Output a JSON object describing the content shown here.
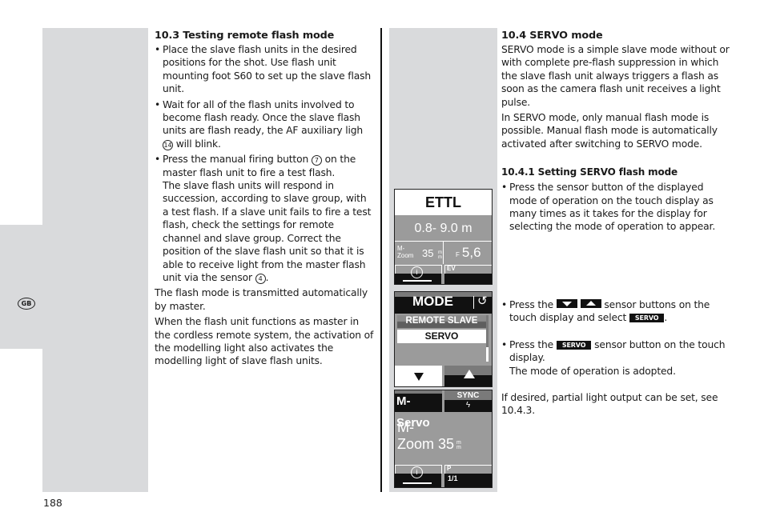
{
  "page": {
    "number": "188",
    "language_badge": "GB"
  },
  "left": {
    "heading": "10.3 Testing remote flash mode",
    "bullets": [
      {
        "text": "Place the slave flash units in the desired positions for the shot. Use flash unit mounting foot S60 to set up the slave flash unit."
      },
      {
        "pre": "Wait for all of the flash units involved to become flash ready. Once the slave flash units are flash ready, the AF auxiliary ligh ",
        "ref": "14",
        "post": " will blink."
      },
      {
        "pre": "Press the manual firing button ",
        "ref": "7",
        "mid": " on the master flash unit to fire a test flash.",
        "extra_pre": "The slave flash units will respond in succession, according to slave group, with a test flash. If a slave unit fails to fire a test flash, check the settings for remote channel and slave group. Correct the position of the slave flash unit so that it is able to receive light from the master flash unit via the sensor ",
        "ref2": "4",
        "extra_post": "."
      }
    ],
    "paragraphs": [
      "The flash mode is transmitted automatically by master.",
      "When the flash unit functions as master in the cordless remote system, the activation of the modelling light also activates the modelling light of slave flash units."
    ]
  },
  "screens": {
    "ettl": {
      "title": "ETTL",
      "range": "0.8- 9.0 m",
      "zoom_label_1": "M-",
      "zoom_label_2": "Zoom",
      "zoom_value": "35",
      "zoom_unit_1": "m",
      "zoom_unit_2": "m",
      "aperture_label": "F",
      "aperture_value": "5,6",
      "info_icon": "i",
      "ev_label": "EV"
    },
    "mode": {
      "title": "MODE",
      "back_icon": "↺",
      "options": [
        "REMOTE SLAVE",
        "SERVO"
      ],
      "selected": "SERVO",
      "scroll_position": 0.7
    },
    "mservo": {
      "title": "M-Servo",
      "sync_label": "SYNC",
      "sync_icon": "ϟ",
      "zoom_label": "M-",
      "zoom_text": "Zoom 35",
      "zoom_unit_1": "m",
      "zoom_unit_2": "m",
      "info_icon": "i",
      "p_label": "P",
      "page_indicator": "1/1"
    }
  },
  "right": {
    "heading": "10.4 SERVO mode",
    "paragraphs": [
      "SERVO mode is a simple slave mode without or with complete pre-flash suppression in which the slave flash unit always triggers a flash as soon as the camera flash unit receives a light pulse.",
      "In SERVO mode, only manual flash mode is possible. Manual flash mode is automatically activated after switching to SERVO mode."
    ],
    "subheading": "10.4.1 Setting SERVO flash mode",
    "step1": "Press the sensor button of the displayed mode of operation on the touch display as many times as it takes for the display for selecting the mode of operation to appear.",
    "step2_pre": "Press the",
    "step2_post": "sensor buttons on the touch display and select",
    "step2_end": ".",
    "step3_pre": "Press the",
    "step3_post": "sensor button on the touch display.",
    "step3_line2": "The mode of operation is adopted.",
    "servo_button": "SERVO",
    "note": "If desired, partial light output can be set, see 10.4.3."
  }
}
